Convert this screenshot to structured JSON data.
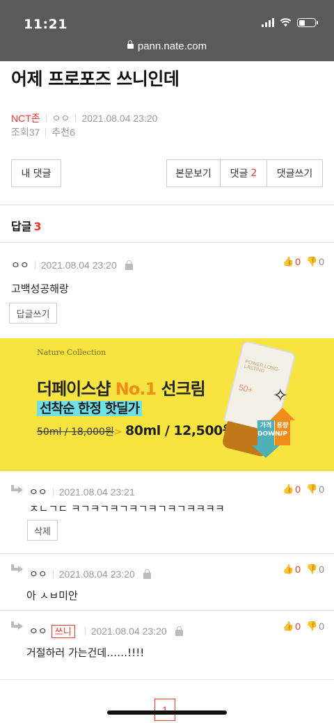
{
  "status_bar": {
    "time": "11:21"
  },
  "browser": {
    "url": "pann.nate.com"
  },
  "post": {
    "title": "어제 프로포즈 쓰니인데",
    "category": "NCT존",
    "author": "ㅇㅇ",
    "datetime": "2021.08.04 23:20",
    "views_label": "조회",
    "views": "37",
    "recommend_label": "추천",
    "recommend": "6"
  },
  "actions": {
    "my_comments": "내 댓글",
    "view_body": "본문보기",
    "comments_label": "댓글",
    "comments_count": "2",
    "write_comment": "댓글쓰기"
  },
  "replies": {
    "label": "답글",
    "count": "3",
    "main": {
      "nick": "ㅇㅇ",
      "datetime": "2021.08.04 23:20",
      "up": "0",
      "down": "0",
      "text": "고백성공해랑",
      "reply_button": "답글쓰기"
    },
    "items": [
      {
        "nick": "ㅇㅇ",
        "datetime": "2021.08.04 23:21",
        "up": "0",
        "down": "0",
        "text": "ㅈㄴㄱㄷ ㅋㄱㅋㄱㅋㄱㅋㄱㅋㄱㅋㄱㅋㅋㅋㅋ",
        "button": "삭제"
      },
      {
        "nick": "ㅇㅇ",
        "datetime": "2021.08.04 23:20",
        "up": "0",
        "down": "0",
        "text": "아 ㅅㅂ미안"
      },
      {
        "nick": "ㅇㅇ",
        "badge": "쓰니",
        "datetime": "2021.08.04 23:20",
        "up": "0",
        "down": "0",
        "text": "거절하러 가는건데……!!!!"
      }
    ]
  },
  "ad": {
    "brand": "Nature Collection",
    "line1_a": "더페이스샵 ",
    "line1_b": "No.1",
    "line1_c": " 선크림",
    "line2": "선착순 한정 핫딜가",
    "old_price": "50ml / 18,000원",
    "arrow": ">",
    "new_price": "80ml / 12,500원",
    "product_name": "POWER LONG-LASTING",
    "product_spf": "50+",
    "tag_up": "용량 UP",
    "tag_down": "가격 DOWN",
    "accent": "#f08c1a",
    "background": "#f8e440"
  },
  "pagination": {
    "current": "1"
  },
  "colors": {
    "accent_red": "#e33333",
    "topbar": "#5a5a5a"
  }
}
